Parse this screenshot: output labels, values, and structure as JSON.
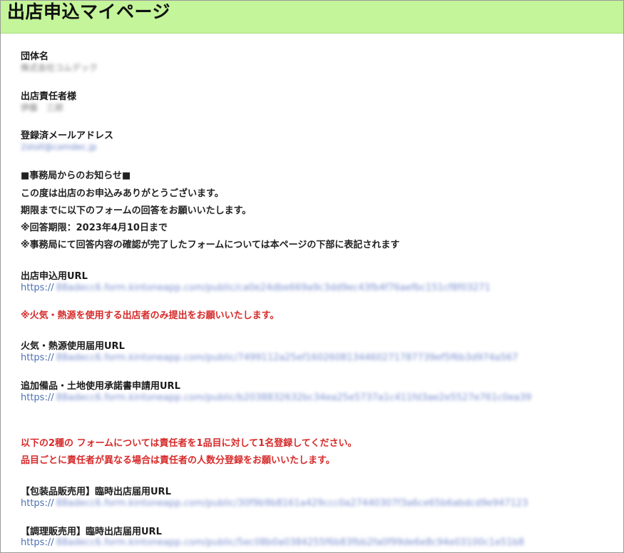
{
  "header": {
    "title": "出店申込マイページ",
    "bg_color": "#c4f59a"
  },
  "profile": {
    "org_label": "団体名",
    "org_value": "株式会社コムデック",
    "manager_label": "出店責任者様",
    "manager_value": "伊藤　三郎",
    "email_label": "登録済メールアドレス",
    "email_value": "2stoll@comdec.jp"
  },
  "notice": {
    "heading": "■事務局からのお知らせ■",
    "lines": [
      "この度は出店のお申込みありがとうございます。",
      "期限までに以下のフォームの回答をお願いいたします。",
      "※回答期限：2023年4月10日まで",
      "※事務局にて回答内容の確認が完了したフォームについては本ページの下部に表記されます"
    ]
  },
  "forms": {
    "entry": {
      "label": "出店申込用URL",
      "prefix": "https://",
      "rest": "88adecc6.form.kintoneapp.com/public/ca0e24dbe669a9c3dd9ec43fb4f76aefbc151cf8f03271"
    },
    "fire_note": "※火気・熱源を使用する出店者のみ提出をお願いいたします。",
    "fire": {
      "label": "火気・熱源使用届用URL",
      "prefix": "https://",
      "rest": "88adecc6.form.kintoneapp.com/public/7499112a25ef1602608134460271787739ef5f6b3d974a567"
    },
    "equipment": {
      "label": "追加備品・土地使用承諾書申請用URL",
      "prefix": "https://",
      "rest": "88adecc6.form.kintoneapp.com/public/b2038832632bc34ea25e5737a1c411fd3ae2e5527e761c0ea39"
    },
    "register_note_lines": [
      "以下の2種の フォームについては責任者を1品目に対して1名登録してください。",
      "品目ごとに責任者が異なる場合は責任者の人数分登録をお願いいたします。"
    ],
    "packaged": {
      "label": "【包装品販売用】臨時出店届用URL",
      "prefix": "https://",
      "rest": "88adecc6.form.kintoneapp.com/public/30f9b9b8161a429ccc0a27440307f3a6ce65b6abdcd9e947123"
    },
    "cooked": {
      "label": "【調理販売用】臨時出店届用URL",
      "prefix": "https://",
      "rest": "88adecc6.form.kintoneapp.com/public/5ec08b0a0384255f6b83fbb2fa0f99de6e8c94e03100c1e51b8"
    }
  }
}
